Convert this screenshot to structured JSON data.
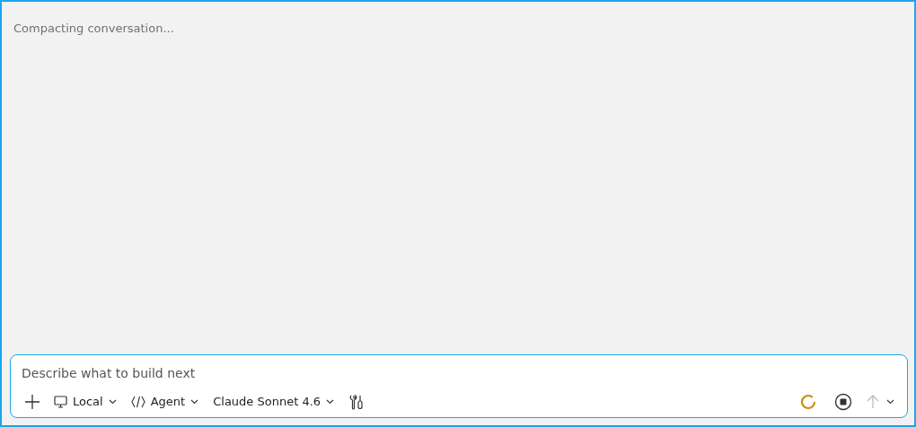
{
  "status": "Compacting conversation...",
  "composer": {
    "placeholder": "Describe what to build next",
    "pickers": [
      {
        "kind": "monitor",
        "label": "Local"
      },
      {
        "kind": "code",
        "label": "Agent"
      },
      {
        "kind": "plain",
        "label": "Claude Sonnet 4.6"
      }
    ],
    "busy": true,
    "send": {
      "disabled": true
    }
  }
}
